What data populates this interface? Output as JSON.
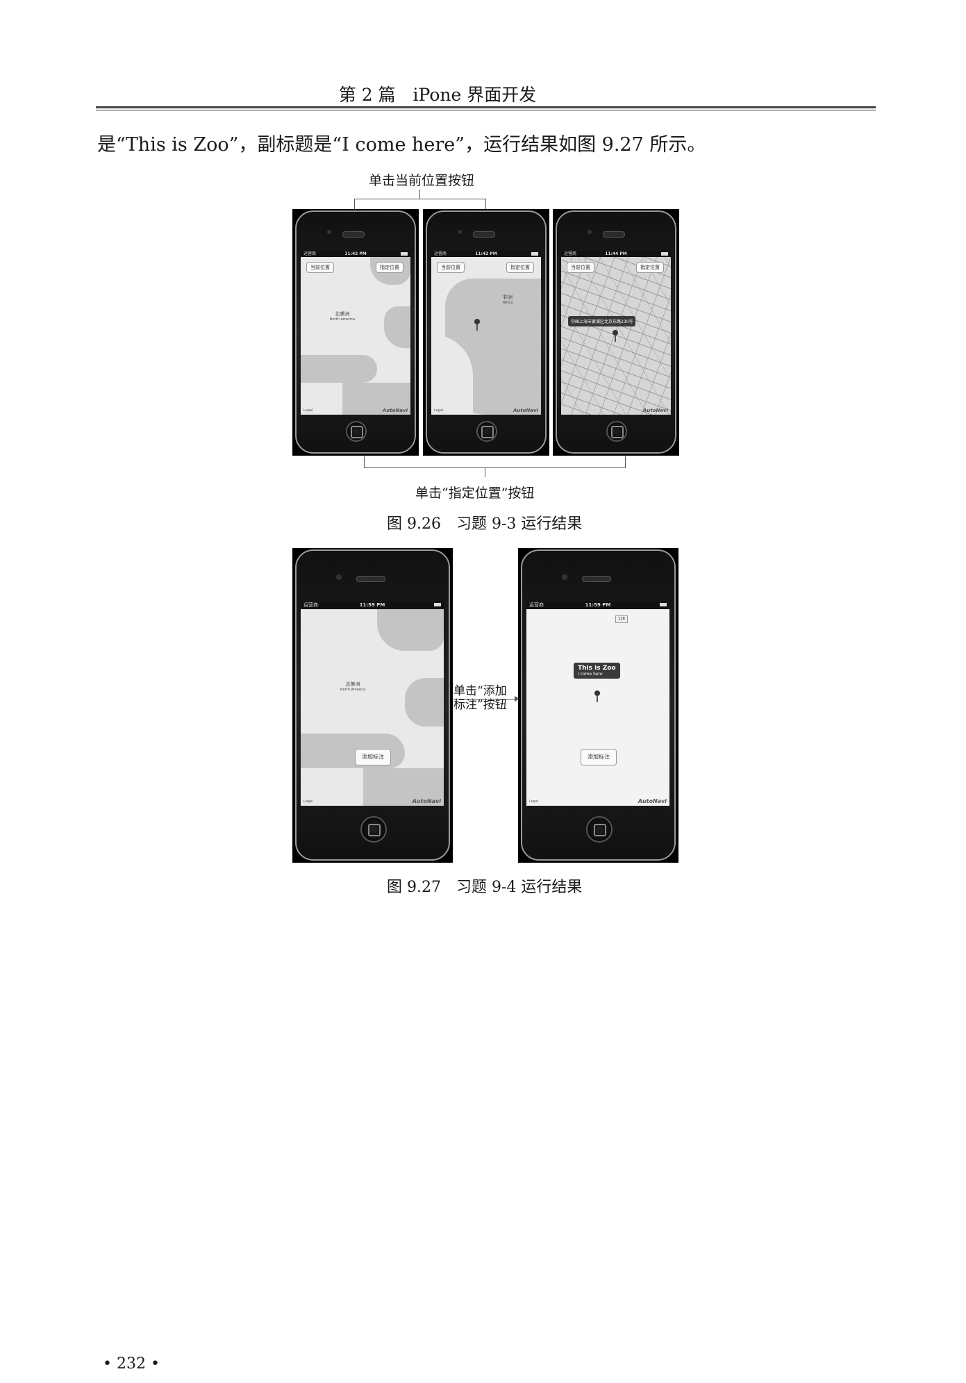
{
  "header": {
    "title": "第 2 篇　iPone 界面开发"
  },
  "body_text": "是“This is Zoo”，副标题是“I come here”，运行结果如图 9.27 所示。",
  "figure_926": {
    "top_annotation": "单击当前位置按钮",
    "bottom_annotation": "单击“指定位置”按钮",
    "caption": "图 9.26　习题 9-3 运行结果",
    "phones": [
      {
        "time": "11:42 PM",
        "carrier": "运营商",
        "btn_current": "当前位置",
        "btn_set": "指定位置",
        "label_cn": "北美洲",
        "label_en": "North America",
        "legal": "Legal",
        "brand": "AutoNavi"
      },
      {
        "time": "11:42 PM",
        "carrier": "运营商",
        "btn_current": "当前位置",
        "btn_set": "指定位置",
        "label_cn": "非洲",
        "label_en": "Africa",
        "legal": "Legal",
        "brand": "AutoNavi"
      },
      {
        "time": "11:44 PM",
        "carrier": "运营商",
        "btn_current": "当前位置",
        "btn_set": "指定位置",
        "callout": "中国上海市黄浦区北京东路230号",
        "brand": "AutoNavi"
      }
    ]
  },
  "figure_927": {
    "arrow_label_1": "单击“添加",
    "arrow_label_2": "标注”按钮",
    "caption": "图 9.27　习题 9-4 运行结果",
    "phones": [
      {
        "time": "11:59 PM",
        "carrier": "运营商",
        "btn_add": "添加标注",
        "label_cn": "北美洲",
        "label_en": "North America",
        "legal": "Legal",
        "brand": "AutoNavi"
      },
      {
        "time": "11:59 PM",
        "carrier": "运营商",
        "btn_add": "添加标注",
        "callout_title": "This is Zoo",
        "callout_subtitle": "I come here",
        "road": "116",
        "legal": "Legal",
        "brand": "AutoNavi"
      }
    ]
  },
  "page_number": "• 232 •"
}
